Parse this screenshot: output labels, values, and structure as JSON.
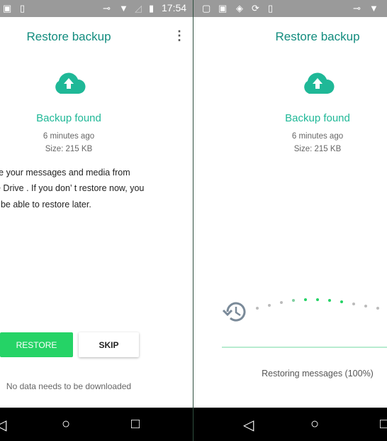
{
  "left": {
    "status": {
      "time": "17:54",
      "icons": [
        "image-icon",
        "phone-download-icon",
        "key-icon",
        "wifi-icon",
        "no-signal-icon",
        "battery-icon"
      ]
    },
    "title": "Restore backup",
    "backup_found": "Backup found",
    "time_ago": "6 minutes ago",
    "size": "Size: 215 KB",
    "message_lines": [
      "re your messages and media from",
      "e Drive . If you don’ t restore now, you",
      "t  be able to restore later."
    ],
    "restore_label": "RESTORE",
    "skip_label": "SKIP",
    "footer": "No data needs to be downloaded"
  },
  "right": {
    "status": {
      "icons": [
        "screen-icon",
        "image-icon",
        "shield-icon",
        "sync-icon",
        "phone-download-icon",
        "key-icon",
        "wifi-icon"
      ]
    },
    "title": "Restore backup",
    "backup_found": "Backup found",
    "time_ago": "6 minutes ago",
    "size": "Size: 215 KB",
    "progress_text": "Restoring messages (100%)",
    "progress_percent": 100
  },
  "colors": {
    "accent": "#128c7e",
    "green": "#25d366",
    "teal": "#1fb897"
  }
}
